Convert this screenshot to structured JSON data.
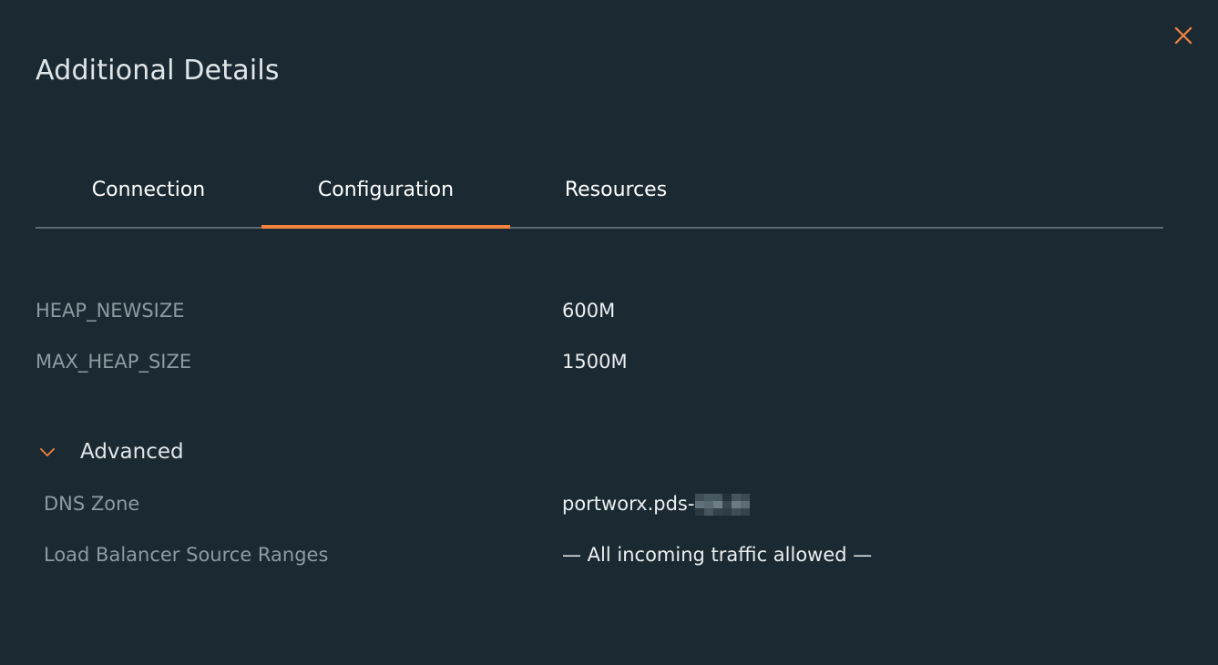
{
  "window": {
    "title": "Additional Details",
    "background_color": "#1b2a32",
    "accent_color": "#f2833f",
    "label_color": "#8d9ba3",
    "value_color": "#e9eef0"
  },
  "close_button": {
    "icon": "close-icon",
    "label": "Close",
    "color": "#f2833f"
  },
  "tabs": {
    "active_index": 1,
    "items": [
      {
        "label": "Connection",
        "active": false
      },
      {
        "label": "Configuration",
        "active": true
      },
      {
        "label": "Resources",
        "active": false
      }
    ]
  },
  "configuration": {
    "rows": [
      {
        "key": "HEAP_NEWSIZE",
        "value": "600M"
      },
      {
        "key": "MAX_HEAP_SIZE",
        "value": "1500M"
      }
    ]
  },
  "advanced": {
    "title": "Advanced",
    "expanded": true,
    "chevron_icon": "chevron-down-icon",
    "rows": [
      {
        "key": "DNS Zone",
        "value": "portworx.pds-",
        "redacted": true
      },
      {
        "key": "Load Balancer Source Ranges",
        "value": "— All incoming traffic allowed —",
        "redacted": false
      }
    ]
  }
}
